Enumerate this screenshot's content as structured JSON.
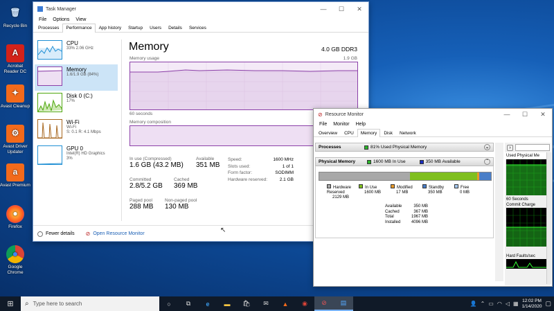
{
  "desktop": {
    "icons": [
      {
        "label": "Recycle Bin"
      },
      {
        "label": "Acrobat Reader DC"
      },
      {
        "label": "Avast Cleanup"
      },
      {
        "label": "Avast Driver Updater"
      },
      {
        "label": "Avast Premium"
      },
      {
        "label": "Firefox"
      },
      {
        "label": "Google Chrome"
      }
    ]
  },
  "taskmgr": {
    "title": "Task Manager",
    "menu": [
      "File",
      "Options",
      "View"
    ],
    "tabs": [
      "Processes",
      "Performance",
      "App history",
      "Startup",
      "Users",
      "Details",
      "Services"
    ],
    "side": [
      {
        "title": "CPU",
        "sub": "33%  2.06 GHz"
      },
      {
        "title": "Memory",
        "sub": "1.6/1.9 GB (84%)"
      },
      {
        "title": "Disk 0 (C:)",
        "sub": "17%"
      },
      {
        "title": "Wi-Fi",
        "sub": "Wi-Fi",
        "sub2": "S: 0.1  R: 4.1 Mbps"
      },
      {
        "title": "GPU 0",
        "sub": "Intel(R) HD Graphics",
        "sub2": "3%"
      }
    ],
    "heading": "Memory",
    "spec": "4.0 GB DDR3",
    "usage_label": "Memory usage",
    "usage_max": "1.9 GB",
    "time_label": "60 seconds",
    "composition_label": "Memory composition",
    "stats": {
      "in_use_label": "In use (Compressed)",
      "in_use": "1.6 GB (43.2 MB)",
      "available_label": "Available",
      "available": "351 MB",
      "committed_label": "Committed",
      "committed": "2.8/5.2 GB",
      "cached_label": "Cached",
      "cached": "369 MB",
      "paged_label": "Paged pool",
      "paged": "288 MB",
      "nonpaged_label": "Non-paged pool",
      "nonpaged": "130 MB"
    },
    "specs": [
      {
        "k": "Speed:",
        "v": "1600 MHz"
      },
      {
        "k": "Slots used:",
        "v": "1 of 1"
      },
      {
        "k": "Form factor:",
        "v": "SODIMM"
      },
      {
        "k": "Hardware reserved:",
        "v": "2.1 GB"
      }
    ],
    "fewer": "Fewer details",
    "open_rm": "Open Resource Monitor"
  },
  "resmon": {
    "title": "Resource Monitor",
    "menu": [
      "File",
      "Monitor",
      "Help"
    ],
    "tabs": [
      "Overview",
      "CPU",
      "Memory",
      "Disk",
      "Network"
    ],
    "processes_label": "Processes",
    "processes_info": "81% Used Physical Memory",
    "physical_label": "Physical Memory",
    "inuse_info": "1600 MB In Use",
    "avail_info": "350 MB Available",
    "legend": [
      {
        "name": "Hardware Reserved",
        "val": "2129 MB",
        "color": "#a8a8a8"
      },
      {
        "name": "In Use",
        "val": "1600 MB",
        "color": "#7fbf1f"
      },
      {
        "name": "Modified",
        "val": "17 MB",
        "color": "#e89a2a"
      },
      {
        "name": "Standby",
        "val": "350 MB",
        "color": "#4a7ec8"
      },
      {
        "name": "Free",
        "val": "0 MB",
        "color": "#a6c8ee"
      }
    ],
    "summary": [
      {
        "k": "Available",
        "v": "350 MB"
      },
      {
        "k": "Cached",
        "v": "367 MB"
      },
      {
        "k": "Total",
        "v": "1967 MB"
      },
      {
        "k": "Installed",
        "v": "4096 MB"
      }
    ],
    "graph_labels": {
      "used": "Used Physical Me",
      "sixty": "60 Seconds",
      "commit": "Commit Charge",
      "hard": "Hard Faults/sec"
    }
  },
  "taskbar": {
    "search": "Type here to search",
    "time": "12:02 PM",
    "date": "1/14/2020"
  }
}
